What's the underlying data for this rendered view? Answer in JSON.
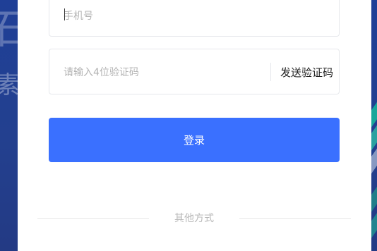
{
  "background": {
    "glyph_top": "石",
    "glyph_bottom": "素"
  },
  "login_form": {
    "phone_placeholder": "手机号",
    "code_placeholder": "请输入4位验证码",
    "send_code_label": "发送验证码",
    "login_label": "登录",
    "other_methods_label": "其他方式"
  },
  "colors": {
    "background": "#23408f",
    "primary_button": "#3a70ff",
    "accent_teal": "#1aa79a"
  }
}
